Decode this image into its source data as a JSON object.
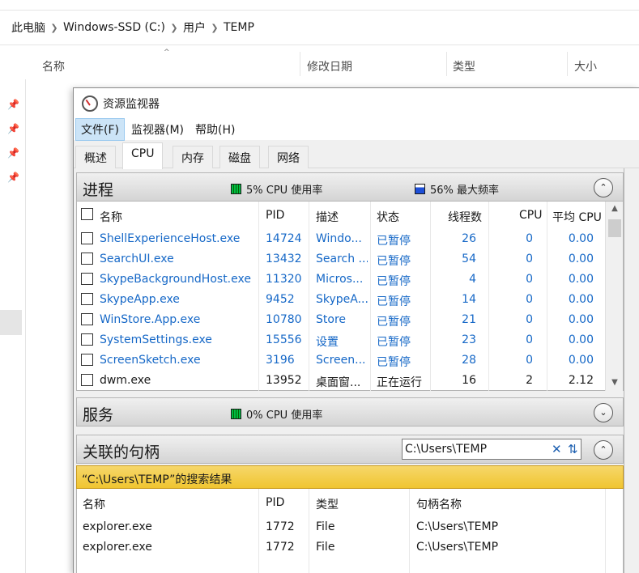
{
  "explorer": {
    "breadcrumb": [
      "此电脑",
      "Windows-SSD (C:)",
      "用户",
      "TEMP"
    ],
    "columns": {
      "name": "名称",
      "modified": "修改日期",
      "type": "类型",
      "size": "大小"
    }
  },
  "resmon": {
    "title": "资源监视器",
    "menu": [
      "文件(F)",
      "监视器(M)",
      "帮助(H)"
    ],
    "tabs": [
      "概述",
      "CPU",
      "内存",
      "磁盘",
      "网络"
    ],
    "active_tab": "CPU",
    "processes": {
      "title": "进程",
      "cpu_usage": "5% CPU 使用率",
      "max_freq": "56% 最大频率",
      "columns": [
        "名称",
        "PID",
        "描述",
        "状态",
        "线程数",
        "CPU",
        "平均 CPU"
      ],
      "rows": [
        {
          "name": "ShellExperienceHost.exe",
          "pid": "14724",
          "desc": "Windo...",
          "status": "已暂停",
          "threads": "26",
          "cpu": "0",
          "avg": "0.00",
          "link": true
        },
        {
          "name": "SearchUI.exe",
          "pid": "13432",
          "desc": "Search ...",
          "status": "已暂停",
          "threads": "54",
          "cpu": "0",
          "avg": "0.00",
          "link": true
        },
        {
          "name": "SkypeBackgroundHost.exe",
          "pid": "11320",
          "desc": "Micros...",
          "status": "已暂停",
          "threads": "4",
          "cpu": "0",
          "avg": "0.00",
          "link": true
        },
        {
          "name": "SkypeApp.exe",
          "pid": "9452",
          "desc": "SkypeA...",
          "status": "已暂停",
          "threads": "14",
          "cpu": "0",
          "avg": "0.00",
          "link": true
        },
        {
          "name": "WinStore.App.exe",
          "pid": "10780",
          "desc": "Store",
          "status": "已暂停",
          "threads": "21",
          "cpu": "0",
          "avg": "0.00",
          "link": true
        },
        {
          "name": "SystemSettings.exe",
          "pid": "15556",
          "desc": "设置",
          "status": "已暂停",
          "threads": "23",
          "cpu": "0",
          "avg": "0.00",
          "link": true
        },
        {
          "name": "ScreenSketch.exe",
          "pid": "3196",
          "desc": "Screen...",
          "status": "已暂停",
          "threads": "28",
          "cpu": "0",
          "avg": "0.00",
          "link": true
        },
        {
          "name": "dwm.exe",
          "pid": "13952",
          "desc": "桌面窗...",
          "status": "正在运行",
          "threads": "16",
          "cpu": "2",
          "avg": "2.12",
          "link": false
        }
      ]
    },
    "services": {
      "title": "服务",
      "cpu_usage": "0% CPU 使用率"
    },
    "handles": {
      "title": "关联的句柄",
      "search_value": "C:\\Users\\TEMP",
      "result_banner": "“C:\\Users\\TEMP”的搜索结果",
      "columns": [
        "名称",
        "PID",
        "类型",
        "句柄名称"
      ],
      "rows": [
        {
          "name": "explorer.exe",
          "pid": "1772",
          "type": "File",
          "handle": "C:\\Users\\TEMP"
        },
        {
          "name": "explorer.exe",
          "pid": "1772",
          "type": "File",
          "handle": "C:\\Users\\TEMP"
        }
      ]
    }
  },
  "icons": {
    "pin": "pin-icon",
    "chevron": "chevron-right-icon",
    "collapse_up": "chevron-up-icon",
    "expand_down": "chevron-down-icon",
    "clear": "close-icon",
    "refresh": "refresh-icon"
  },
  "colors": {
    "link": "#1668c7",
    "banner": "#f0c530",
    "menu_active": "#cce4f7"
  }
}
